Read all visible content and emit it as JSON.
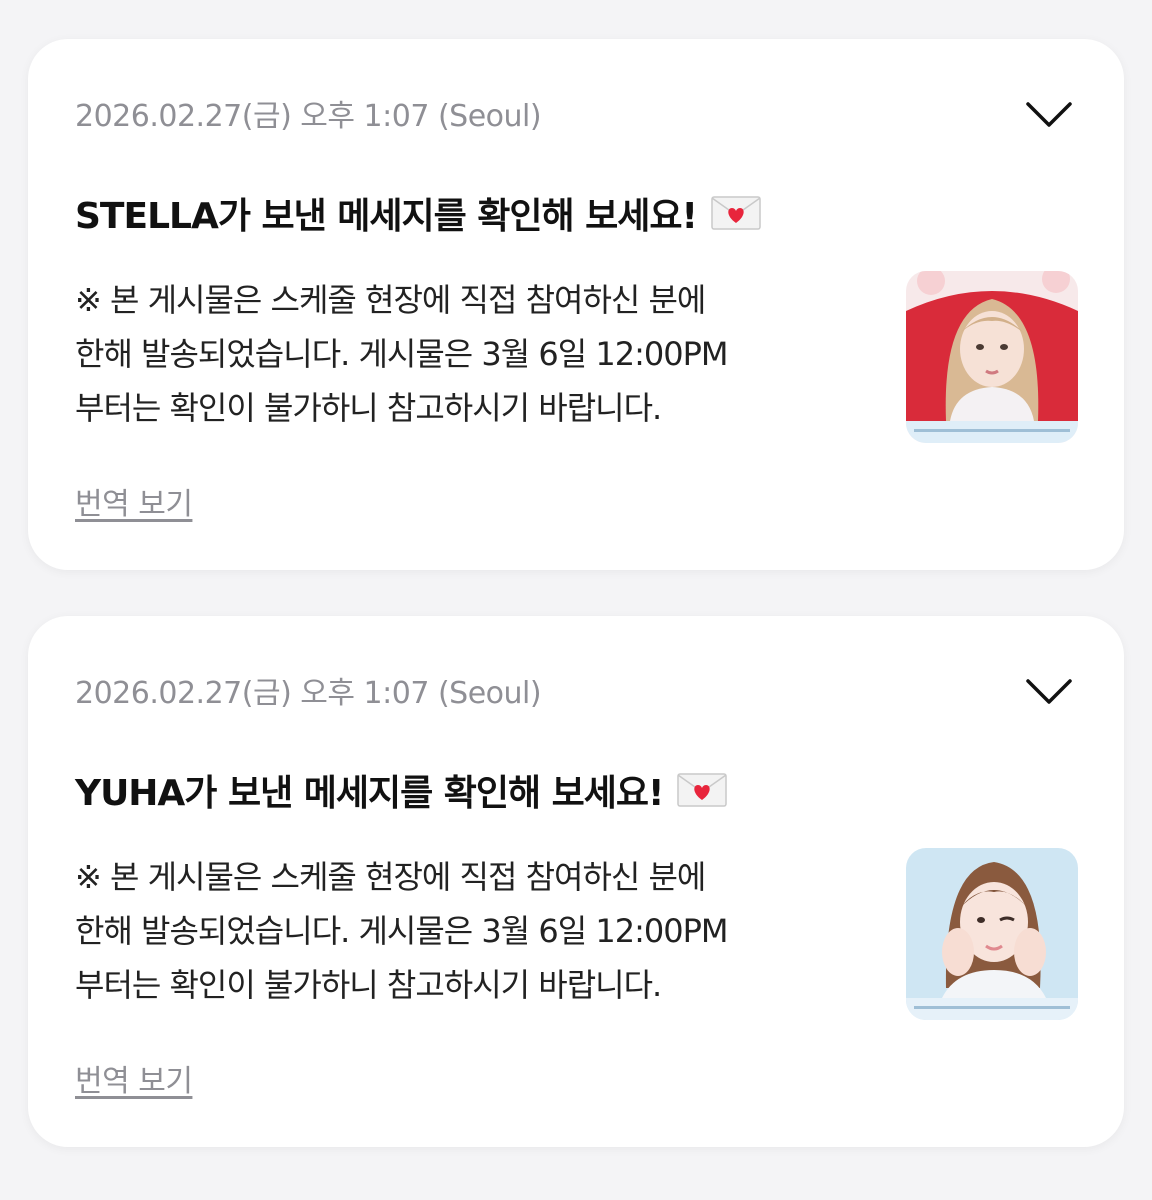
{
  "notifications": [
    {
      "timestamp": "2026.02.27(금) 오후 1:07 (Seoul)",
      "title": "STELLA가 보낸 메세지를 확인해 보세요!",
      "title_emoji": "love-letter-icon",
      "body_lines": [
        "※ 본 게시물은 스케줄 현장에 직접 참여하신 분에",
        "한해 발송되었습니다. 게시물은 3월 6일 12:00PM",
        "부터는 확인이 불가하니 참고하시기 바랍니다."
      ],
      "translate_label": "번역 보기",
      "thumbnail": "photo of STELLA with red background"
    },
    {
      "timestamp": "2026.02.27(금) 오후 1:07 (Seoul)",
      "title": "YUHA가 보낸 메세지를 확인해 보세요!",
      "title_emoji": "love-letter-icon",
      "body_lines": [
        "※ 본 게시물은 스케줄 현장에 직접 참여하신 분에",
        "한해 발송되었습니다. 게시물은 3월 6일 12:00PM",
        "부터는 확인이 불가하니 참고하시기 바랍니다."
      ],
      "translate_label": "번역 보기",
      "thumbnail": "photo of YUHA with light blue background"
    }
  ],
  "colors": {
    "background": "#f4f4f6",
    "card": "#ffffff",
    "muted_text": "#8f8f95",
    "title_text": "#111111",
    "body_text": "#222222",
    "heart": "#e8253c"
  }
}
